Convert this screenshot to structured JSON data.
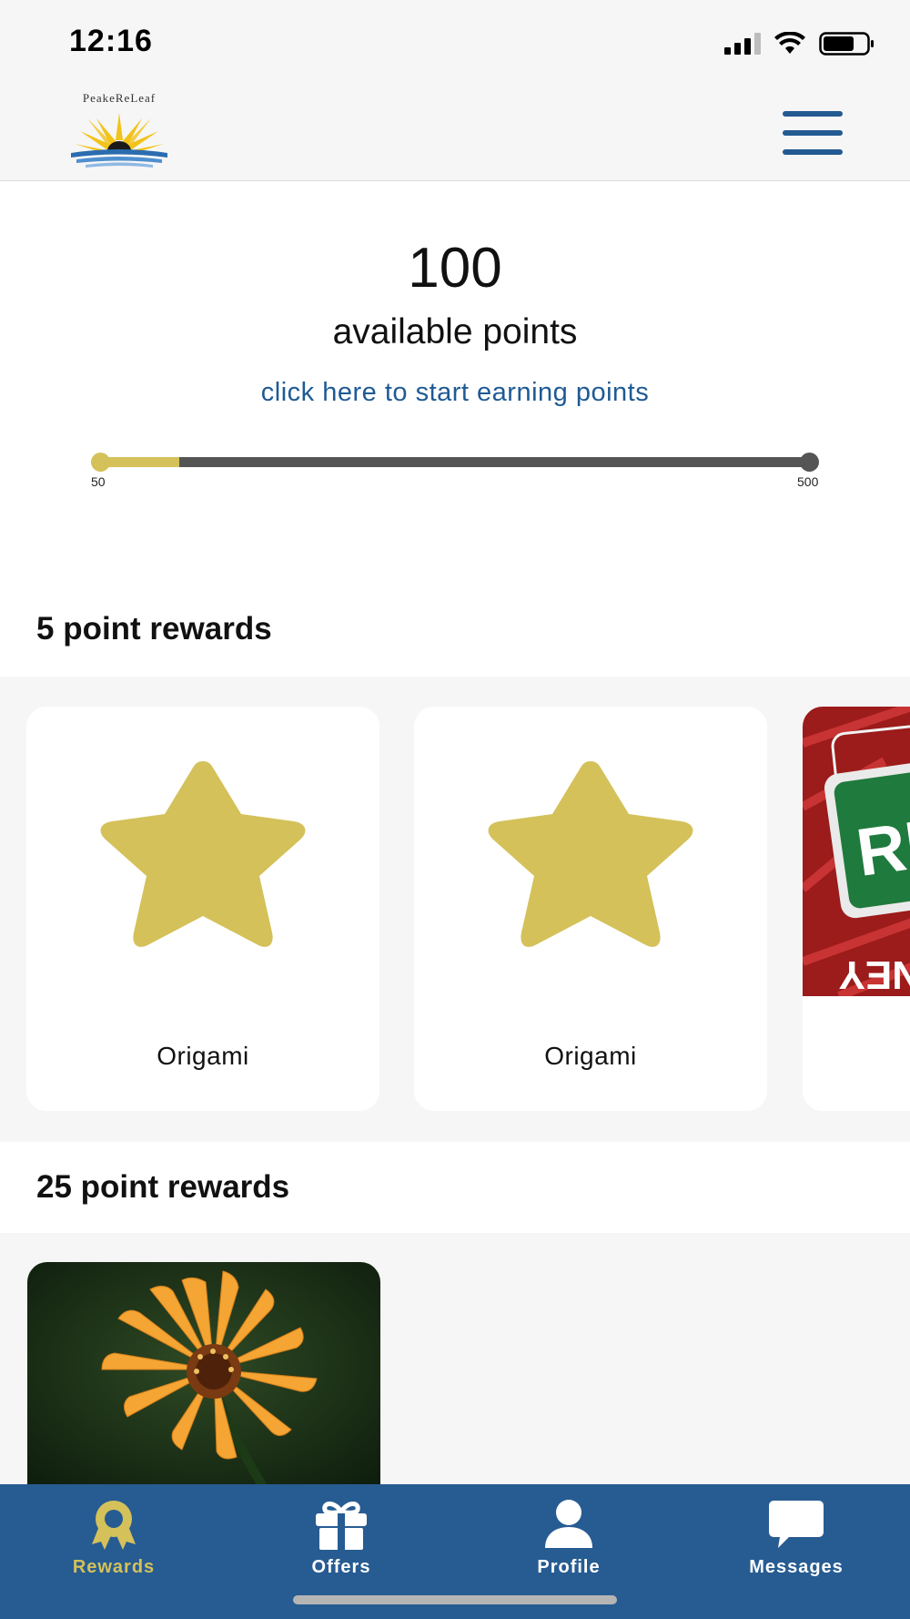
{
  "status_bar": {
    "time": "12:16"
  },
  "header": {
    "logo_text": "PeakeReLeaf"
  },
  "points": {
    "value": "100",
    "label": "available points",
    "earn_link": "click here to start earning points",
    "progress": {
      "min_label": "50",
      "max_label": "500",
      "min": 50,
      "max": 500,
      "current": 100
    }
  },
  "sections": [
    {
      "title": "5 point rewards",
      "cards": [
        {
          "label": "Origami",
          "image": "star-icon"
        },
        {
          "label": "Origami",
          "image": "star-icon"
        },
        {
          "label": "",
          "image": "red-sign-photo"
        }
      ]
    },
    {
      "title": "25 point rewards",
      "cards": [
        {
          "label": "",
          "image": "orange-flower-photo"
        }
      ]
    }
  ],
  "bottom_nav": {
    "active": "Rewards",
    "items": [
      {
        "label": "Rewards",
        "icon": "award-ribbon-icon"
      },
      {
        "label": "Offers",
        "icon": "gift-icon"
      },
      {
        "label": "Profile",
        "icon": "person-icon"
      },
      {
        "label": "Messages",
        "icon": "speech-bubble-icon"
      }
    ]
  },
  "colors": {
    "brand_blue": "#275c92",
    "link_blue": "#1f5a94",
    "accent_gold": "#d4c15a",
    "track_gray": "#555555"
  }
}
